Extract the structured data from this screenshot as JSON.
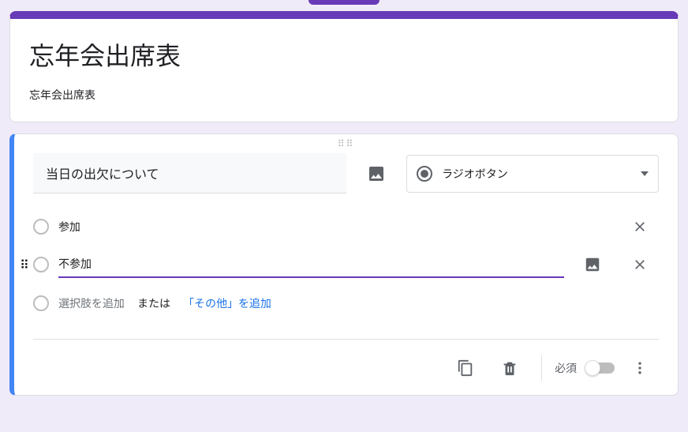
{
  "colors": {
    "accent": "#673ab7",
    "focus_border": "#4285f4",
    "link": "#1a73e8"
  },
  "form": {
    "title": "忘年会出席表",
    "description": "忘年会出席表"
  },
  "question": {
    "title": "当日の出欠について",
    "type_label": "ラジオボタン",
    "options": [
      {
        "label": "参加",
        "focused": false,
        "deletable": true,
        "image_btn": false
      },
      {
        "label": "不参加",
        "focused": true,
        "deletable": true,
        "image_btn": true
      }
    ],
    "add_option_placeholder": "選択肢を追加",
    "add_or": "または",
    "add_other_label": "「その他」を追加",
    "required_label": "必須",
    "required_on": false
  }
}
